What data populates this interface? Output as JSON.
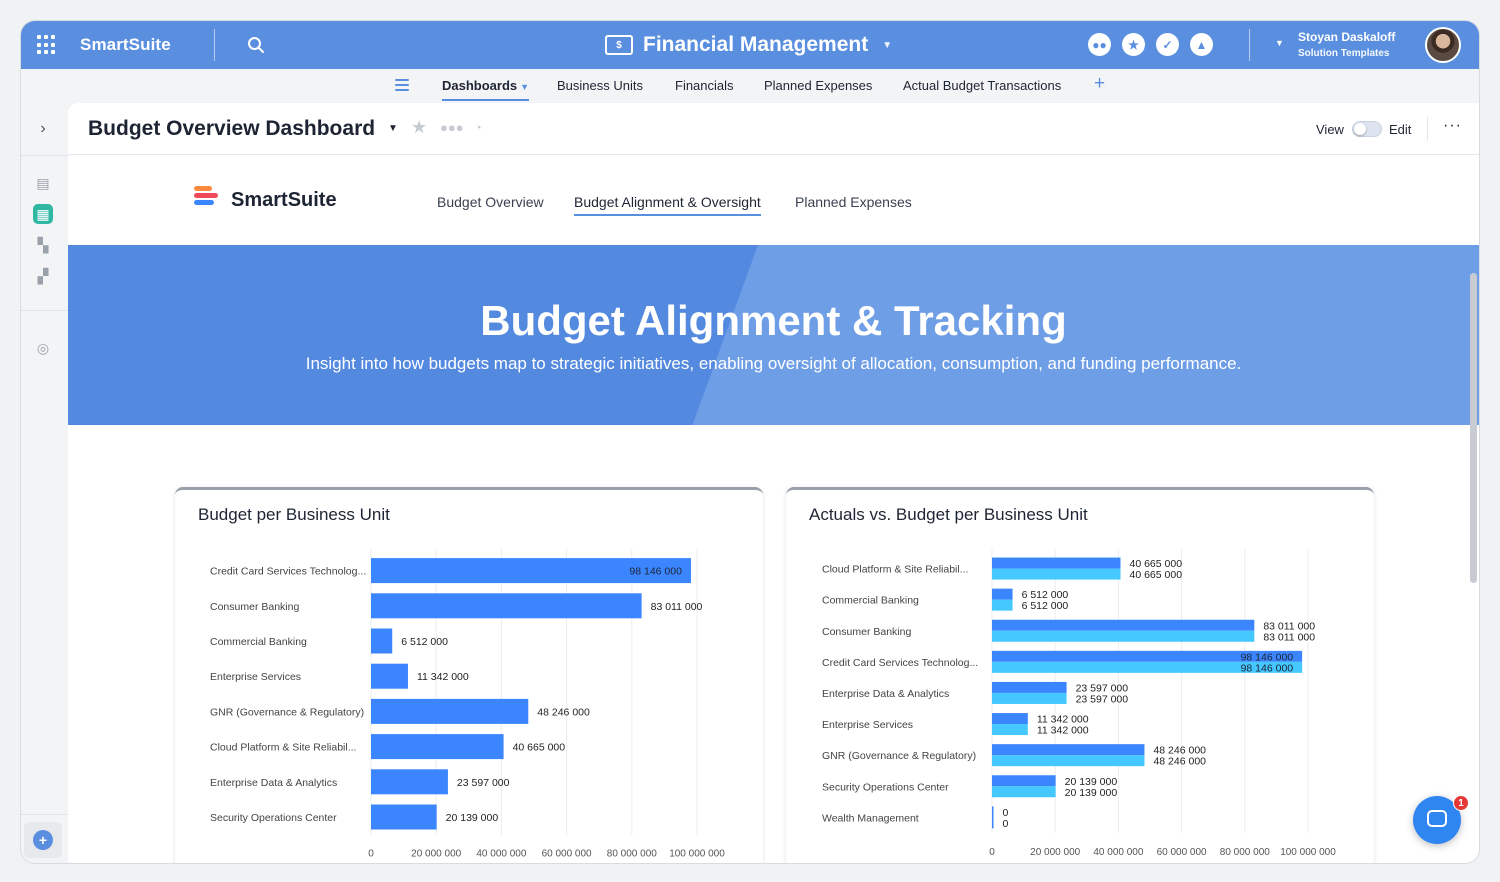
{
  "topbar": {
    "brand": "SmartSuite",
    "app_icon": "$",
    "app_title": "Financial Management",
    "user_name": "Stoyan Daskaloff",
    "user_subtitle": "Solution Templates",
    "icons": [
      "team-icon",
      "star-icon",
      "check-icon",
      "bell-icon"
    ]
  },
  "tabs": [
    {
      "label": "Dashboards",
      "active": true
    },
    {
      "label": "Business Units"
    },
    {
      "label": "Financials"
    },
    {
      "label": "Planned Expenses"
    },
    {
      "label": "Actual Budget Transactions"
    }
  ],
  "tab_add": "+",
  "dashboard": {
    "title": "Budget Overview Dashboard",
    "view_label": "View",
    "edit_label": "Edit",
    "more": "···"
  },
  "nav": {
    "logo_text": "SmartSuite",
    "links": [
      {
        "label": "Budget Overview"
      },
      {
        "label": "Budget Alignment & Oversight",
        "active": true
      },
      {
        "label": "Planned Expenses"
      }
    ]
  },
  "banner": {
    "title": "Budget Alignment & Tracking",
    "subtitle": "Insight into how budgets map to strategic initiatives, enabling oversight of allocation, consumption, and funding performance."
  },
  "chat_badge": "1",
  "colors": {
    "topbar": "#5a8fe0",
    "banner": "#5489e0",
    "budget_bar": "#3b86ff",
    "actual_bar": "#45c8ff",
    "side_active": "#30b7a4"
  },
  "chart_data": [
    {
      "type": "bar",
      "orientation": "horizontal",
      "title": "Budget per Business Unit",
      "categories": [
        "Credit Card Services Technolog...",
        "Consumer Banking",
        "Commercial Banking",
        "Enterprise Services",
        "GNR (Governance & Regulatory)",
        "Cloud Platform & Site Reliabil...",
        "Enterprise Data & Analytics",
        "Security Operations Center"
      ],
      "series": [
        {
          "values": [
            98146000,
            83011000,
            6512000,
            11342000,
            48246000,
            40665000,
            23597000,
            20139000
          ]
        }
      ],
      "value_labels": [
        "98 146 000",
        "83 011 000",
        "6 512 000",
        "11 342 000",
        "48 246 000",
        "40 665 000",
        "23 597 000",
        "20 139 000"
      ],
      "xlim": [
        0,
        100000000
      ],
      "xticks": [
        "0",
        "20 000 000",
        "40 000 000",
        "60 000 000",
        "80 000 000",
        "100 000 000"
      ],
      "grid": true
    },
    {
      "type": "bar",
      "orientation": "horizontal",
      "title": "Actuals vs. Budget per Business Unit",
      "categories": [
        "Cloud Platform & Site Reliabil...",
        "Commercial Banking",
        "Consumer Banking",
        "Credit Card Services Technolog...",
        "Enterprise Data & Analytics",
        "Enterprise Services",
        "GNR (Governance & Regulatory)",
        "Security Operations Center",
        "Wealth Management"
      ],
      "series": [
        {
          "values": [
            40665000,
            6512000,
            83011000,
            98146000,
            23597000,
            11342000,
            48246000,
            20139000,
            0
          ]
        },
        {
          "values": [
            40665000,
            6512000,
            83011000,
            98146000,
            23597000,
            11342000,
            48246000,
            20139000,
            0
          ]
        }
      ],
      "value_labels": [
        "40 665 000",
        "6 512 000",
        "83 011 000",
        "98 146 000",
        "23 597 000",
        "11 342 000",
        "48 246 000",
        "20 139 000",
        "0"
      ],
      "xlim": [
        0,
        100000000
      ],
      "xticks": [
        "0",
        "20 000 000",
        "40 000 000",
        "60 000 000",
        "80 000 000",
        "100 000 000"
      ],
      "grid": true
    }
  ]
}
